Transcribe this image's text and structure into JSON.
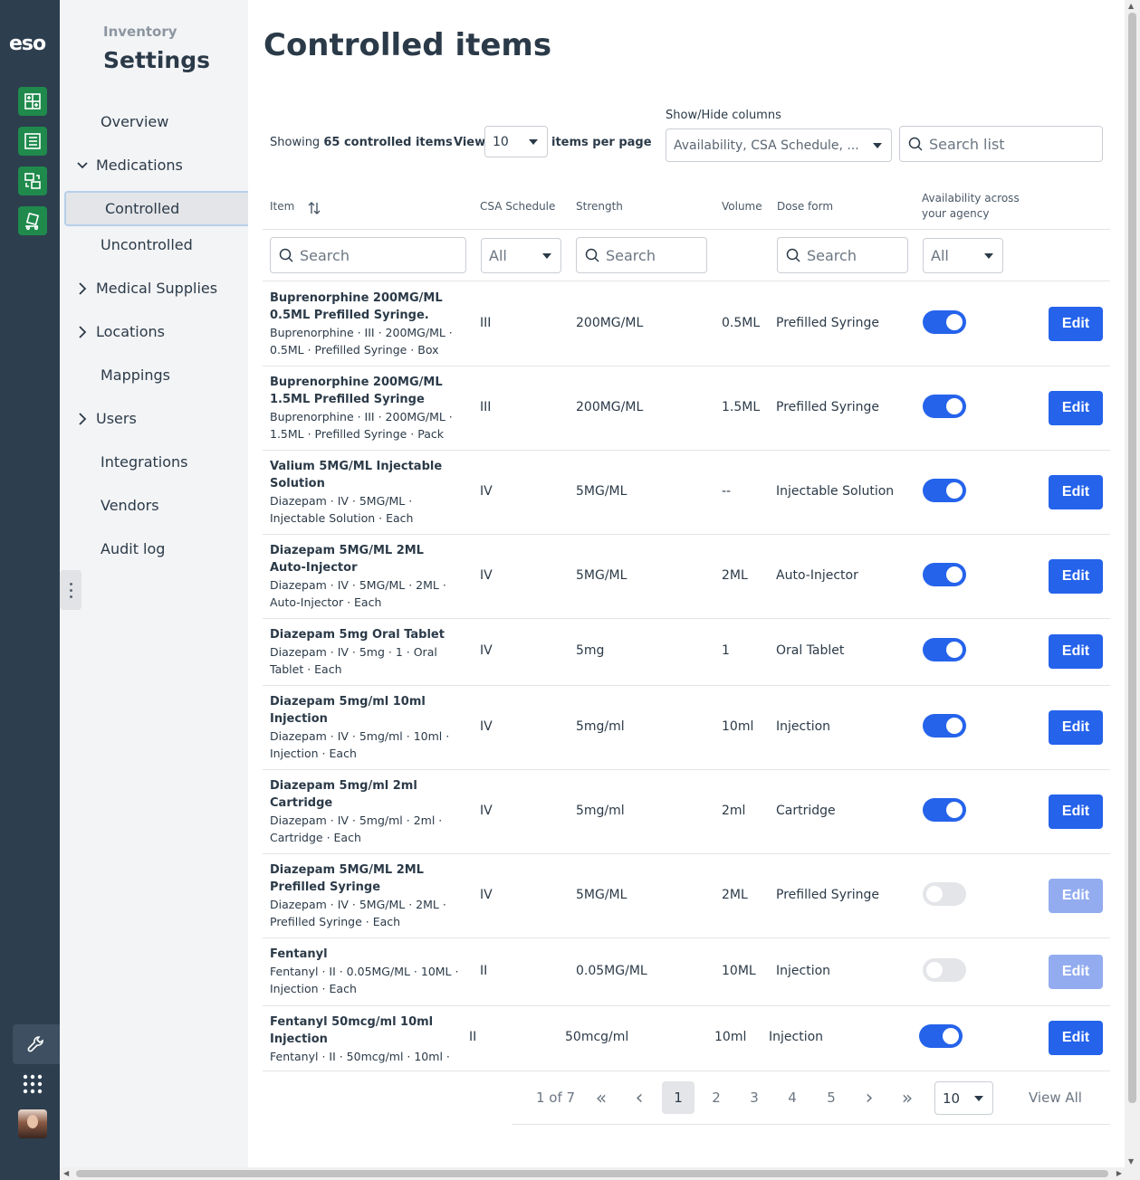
{
  "rail": {
    "logo": "eso",
    "apps": [
      "inventory-app-icon",
      "checklist-app-icon",
      "transfer-app-icon",
      "cart-app-icon"
    ]
  },
  "nav": {
    "crumb": "Inventory",
    "title": "Settings",
    "items": {
      "overview": "Overview",
      "medications": "Medications",
      "controlled": "Controlled",
      "uncontrolled": "Uncontrolled",
      "medical_supplies": "Medical Supplies",
      "locations": "Locations",
      "mappings": "Mappings",
      "users": "Users",
      "integrations": "Integrations",
      "vendors": "Vendors",
      "audit_log": "Audit log"
    }
  },
  "main": {
    "title": "Controlled items",
    "showing_prefix": "Showing",
    "showing_count": "65 controlled items",
    "view_label": "View",
    "view_value": "10",
    "per_page_label": "items per page",
    "columns_label": "Show/Hide columns",
    "columns_value": "Availability, CSA Schedule, ...",
    "search_list_placeholder": "Search list"
  },
  "table": {
    "headers": {
      "item": "Item",
      "csa": "CSA Schedule",
      "strength": "Strength",
      "volume": "Volume",
      "dose_form": "Dose form",
      "availability_1": "Availability across",
      "availability_2": "your agency"
    },
    "filters": {
      "item_search": "Search",
      "csa_value": "All",
      "strength_search": "Search",
      "dose_search": "Search",
      "availability_value": "All"
    },
    "edit_label": "Edit",
    "rows": [
      {
        "title": "Buprenorphine 200MG/ML 0.5ML Prefilled Syringe.",
        "desc": "Buprenorphine · III · 200MG/ML · 0.5ML · Prefilled Syringe · Box",
        "csa": "III",
        "strength": "200MG/ML",
        "volume": "0.5ML",
        "dose": "Prefilled Syringe",
        "available": true
      },
      {
        "title": "Buprenorphine 200MG/ML 1.5ML Prefilled Syringe",
        "desc": "Buprenorphine · III · 200MG/ML · 1.5ML · Prefilled Syringe · Pack",
        "csa": "III",
        "strength": "200MG/ML",
        "volume": "1.5ML",
        "dose": "Prefilled Syringe",
        "available": true
      },
      {
        "title": "Valium 5MG/ML Injectable Solution",
        "desc": "Diazepam · IV · 5MG/ML · Injectable Solution · Each",
        "csa": "IV",
        "strength": "5MG/ML",
        "volume": "--",
        "dose": "Injectable Solution",
        "available": true
      },
      {
        "title": "Diazepam 5MG/ML 2ML Auto-Injector",
        "desc": "Diazepam · IV · 5MG/ML · 2ML · Auto-Injector · Each",
        "csa": "IV",
        "strength": "5MG/ML",
        "volume": "2ML",
        "dose": "Auto-Injector",
        "available": true
      },
      {
        "title": "Diazepam 5mg Oral Tablet",
        "desc": "Diazepam · IV · 5mg · 1 · Oral Tablet · Each",
        "csa": "IV",
        "strength": "5mg",
        "volume": "1",
        "dose": "Oral Tablet",
        "available": true
      },
      {
        "title": "Diazepam 5mg/ml 10ml Injection",
        "desc": "Diazepam · IV · 5mg/ml · 10ml · Injection · Each",
        "csa": "IV",
        "strength": "5mg/ml",
        "volume": "10ml",
        "dose": "Injection",
        "available": true
      },
      {
        "title": "Diazepam 5mg/ml 2ml Cartridge",
        "desc": "Diazepam · IV · 5mg/ml · 2ml · Cartridge · Each",
        "csa": "IV",
        "strength": "5mg/ml",
        "volume": "2ml",
        "dose": "Cartridge",
        "available": true
      },
      {
        "title": "Diazepam 5MG/ML 2ML Prefilled Syringe",
        "desc": "Diazepam · IV · 5MG/ML · 2ML · Prefilled Syringe · Each",
        "csa": "IV",
        "strength": "5MG/ML",
        "volume": "2ML",
        "dose": "Prefilled Syringe",
        "available": false
      },
      {
        "title": "Fentanyl",
        "desc": "Fentanyl · II · 0.05MG/ML · 10ML · Injection · Each",
        "csa": "II",
        "strength": "0.05MG/ML",
        "volume": "10ML",
        "dose": "Injection",
        "available": false
      },
      {
        "title": "Fentanyl 50mcg/ml 10ml Injection",
        "desc": "Fentanyl · II · 50mcg/ml · 10ml ·",
        "csa": "II",
        "strength": "50mcg/ml",
        "volume": "10ml",
        "dose": "Injection",
        "available": true
      }
    ]
  },
  "pagination": {
    "summary": "1 of 7",
    "first": "«",
    "prev": "‹",
    "pages": [
      "1",
      "2",
      "3",
      "4",
      "5"
    ],
    "next": "›",
    "last": "»",
    "size": "10",
    "view_all": "View All"
  },
  "colors": {
    "rail": "#2d3e4f",
    "app_green": "#1f8a4c",
    "accent": "#2563eb",
    "accent_disabled": "#93acf0"
  }
}
